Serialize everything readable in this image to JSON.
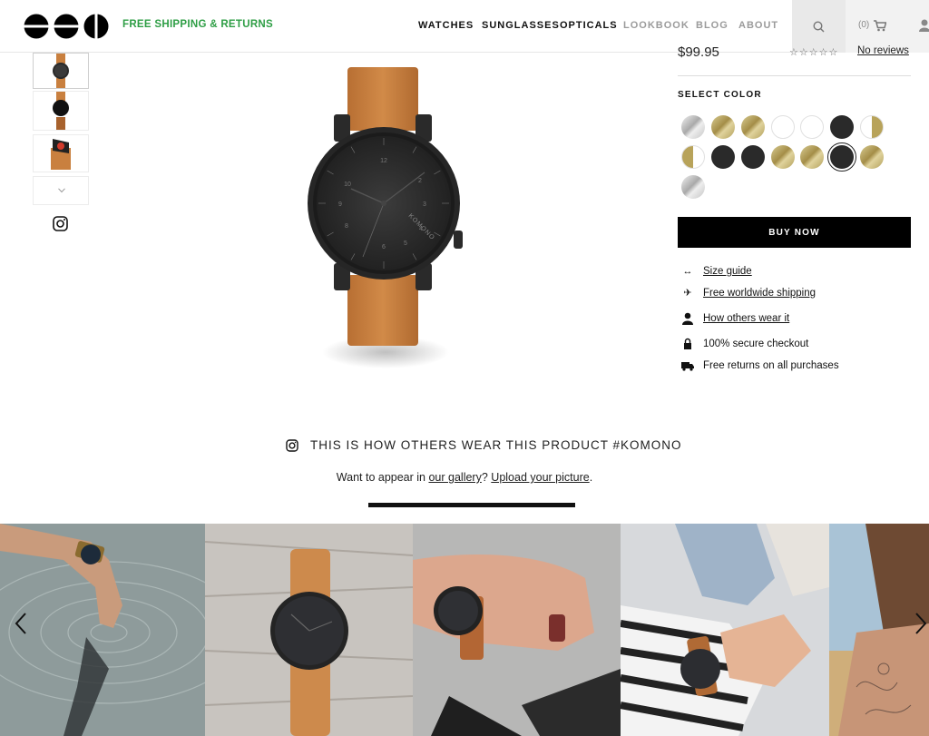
{
  "header": {
    "promo": "FREE SHIPPING & RETURNS",
    "nav": [
      "WATCHES",
      "SUNGLASSES",
      "OPTICALS",
      "LOOKBOOK",
      "BLOG",
      "ABOUT"
    ],
    "cart_count": "(0)"
  },
  "product": {
    "price": "$99.95",
    "rating_stars": "☆☆☆☆☆",
    "reviews_label": "No reviews",
    "select_color_label": "SELECT COLOR",
    "swatches": [
      "silver",
      "gold",
      "gold",
      "white",
      "white",
      "black",
      "white/gold",
      "gold/white",
      "black",
      "black",
      "gold",
      "gold",
      "black",
      "gold",
      "silver"
    ],
    "selected_swatch": 12,
    "buy_now_label": "BUY NOW",
    "features": [
      {
        "icon": "arrows-icon",
        "label": "Size guide"
      },
      {
        "icon": "plane-icon",
        "label": "Free worldwide shipping"
      },
      {
        "icon": "user-icon",
        "label": "How others wear it"
      },
      {
        "icon": "lock-icon",
        "label": "100% secure checkout"
      },
      {
        "icon": "truck-icon",
        "label": "Free returns on all purchases"
      }
    ],
    "watch_brand": "KOMONO",
    "dial_numbers": [
      "12",
      "2",
      "3",
      "4",
      "5",
      "6",
      "8",
      "9",
      "10"
    ]
  },
  "gallery": {
    "title": "THIS IS HOW OTHERS WEAR THIS PRODUCT #KOMONO",
    "sub_prefix": "Want to appear in ",
    "sub_link1": "our gallery",
    "sub_mid": "? ",
    "sub_link2": "Upload your picture",
    "sub_suffix": "."
  },
  "colors": {
    "promo_green": "#2e9e45",
    "strap_tan": "#c9803f",
    "nav_grey": "#9b9b9b"
  }
}
